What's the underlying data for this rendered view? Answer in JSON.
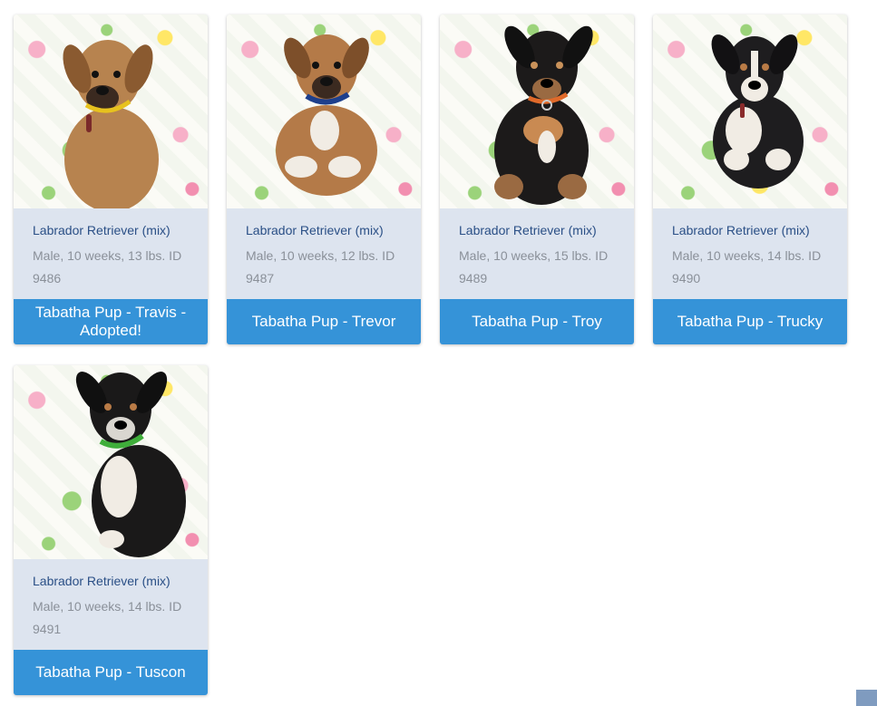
{
  "cards": [
    {
      "breed": "Labrador Retriever (mix)",
      "details": "Male, 10 weeks, 13 lbs. ID 9486",
      "name": "Tabatha Pup - Travis - Adopted!",
      "coat": "#b7834f",
      "collar": "#e7c21e"
    },
    {
      "breed": "Labrador Retriever (mix)",
      "details": "Male, 10 weeks, 12 lbs. ID 9487",
      "name": "Tabatha Pup - Trevor",
      "coat": "#b47a48",
      "collar": "#1d3f8c"
    },
    {
      "breed": "Labrador Retriever (mix)",
      "details": "Male, 10 weeks, 15 lbs. ID 9489",
      "name": "Tabatha Pup - Troy",
      "coat": "#1c1a1a",
      "collar": "#e06a2a"
    },
    {
      "breed": "Labrador Retriever (mix)",
      "details": "Male, 10 weeks, 14 lbs. ID 9490",
      "name": "Tabatha Pup - Trucky",
      "coat": "#1e1d1f",
      "collar": "#8a2b2b"
    },
    {
      "breed": "Labrador Retriever (mix)",
      "details": "Male, 10 weeks, 14 lbs. ID 9491",
      "name": "Tabatha Pup - Tuscon",
      "coat": "#1a1919",
      "collar": "#3fae3a"
    }
  ],
  "scroll_top_icon": "scroll-to-top-icon",
  "colors": {
    "card_bg": "#dde4ef",
    "name_button": "#3593d8",
    "breed_text": "#2a4f86",
    "details_text": "#8a9099"
  }
}
